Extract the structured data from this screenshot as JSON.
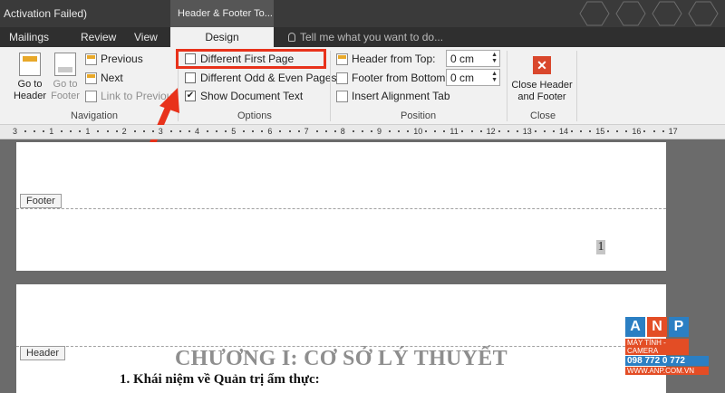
{
  "titlebar": {
    "title": "Activation Failed)",
    "context_tab": "Header & Footer To..."
  },
  "tabs": [
    {
      "label": "Mailings"
    },
    {
      "label": "Review"
    },
    {
      "label": "View"
    },
    {
      "label": "Design"
    }
  ],
  "tell_me": {
    "placeholder": "Tell me what you want to do..."
  },
  "navigation": {
    "go_to_header": "Go to Header",
    "go_to_footer": "Go to Footer",
    "previous": "Previous",
    "next": "Next",
    "link_to_previous": "Link to Previous",
    "group_label": "Navigation"
  },
  "options": {
    "different_first_page": {
      "label": "Different First Page",
      "checked": false
    },
    "different_odd_even": {
      "label": "Different Odd & Even Pages",
      "checked": false
    },
    "show_document_text": {
      "label": "Show Document Text",
      "checked": true
    },
    "group_label": "Options"
  },
  "position": {
    "header_from_top": {
      "label": "Header from Top:",
      "value": "0 cm"
    },
    "footer_from_bottom": {
      "label": "Footer from Bottom:",
      "value": "0 cm"
    },
    "insert_alignment_tab": "Insert Alignment Tab",
    "group_label": "Position"
  },
  "close": {
    "button": "Close Header and Footer",
    "group_label": "Close"
  },
  "ruler": {
    "labels": [
      "3",
      "1",
      "1",
      "2",
      "3",
      "4",
      "5",
      "6",
      "7",
      "8",
      "9",
      "10",
      "11",
      "12",
      "13",
      "14",
      "15",
      "16",
      "17"
    ]
  },
  "page1": {
    "footer_tag": "Footer",
    "page_number": "1"
  },
  "page2": {
    "header_tag": "Header",
    "heading": "CHƯƠNG I: CƠ SỞ LÝ THUYẾT",
    "subheading": "1.   Khái niệm về Quản trị ẩm thực:"
  },
  "watermark": {
    "letters": [
      "A",
      "N",
      "P"
    ],
    "tagline": "MÁY TÍNH - CAMERA",
    "phone": "098 772 0 772",
    "website": "WWW.ANP.COM.VN"
  },
  "colors": {
    "highlight_box": "#e8321b",
    "arrow": "#e8321b",
    "ribbon_bg": "#f1f1f1",
    "titlebar_bg": "#3a3a3a"
  }
}
